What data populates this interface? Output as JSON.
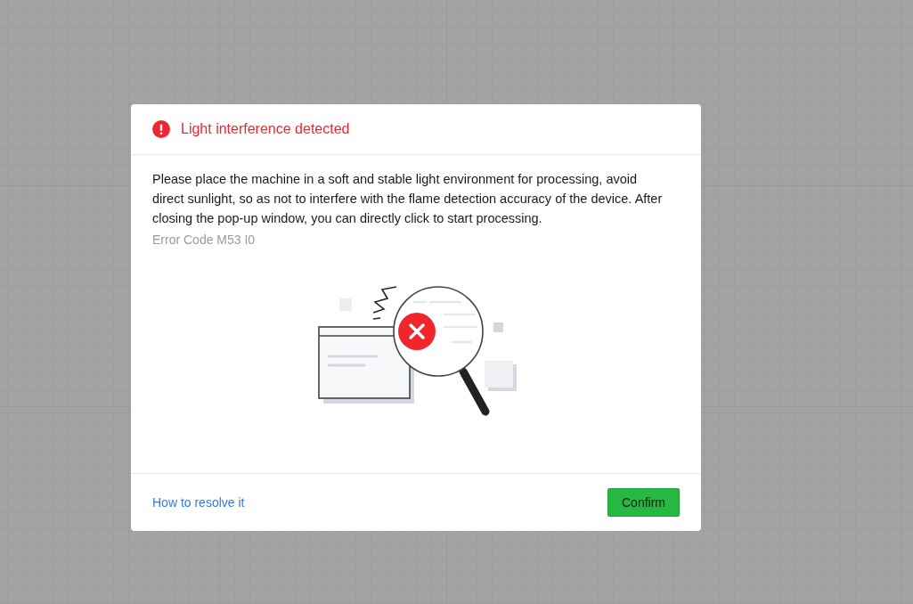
{
  "dialog": {
    "title": "Light interference detected",
    "message": "Please place the machine in a soft and stable light environment for processing, avoid direct sunlight, so as not to interfere with the flame detection accuracy of the device. After closing the pop-up window, you can directly click to start processing.",
    "error_code": "Error Code M53 I0",
    "help_link": "How to resolve it",
    "buttons": [
      "Confirm"
    ]
  }
}
